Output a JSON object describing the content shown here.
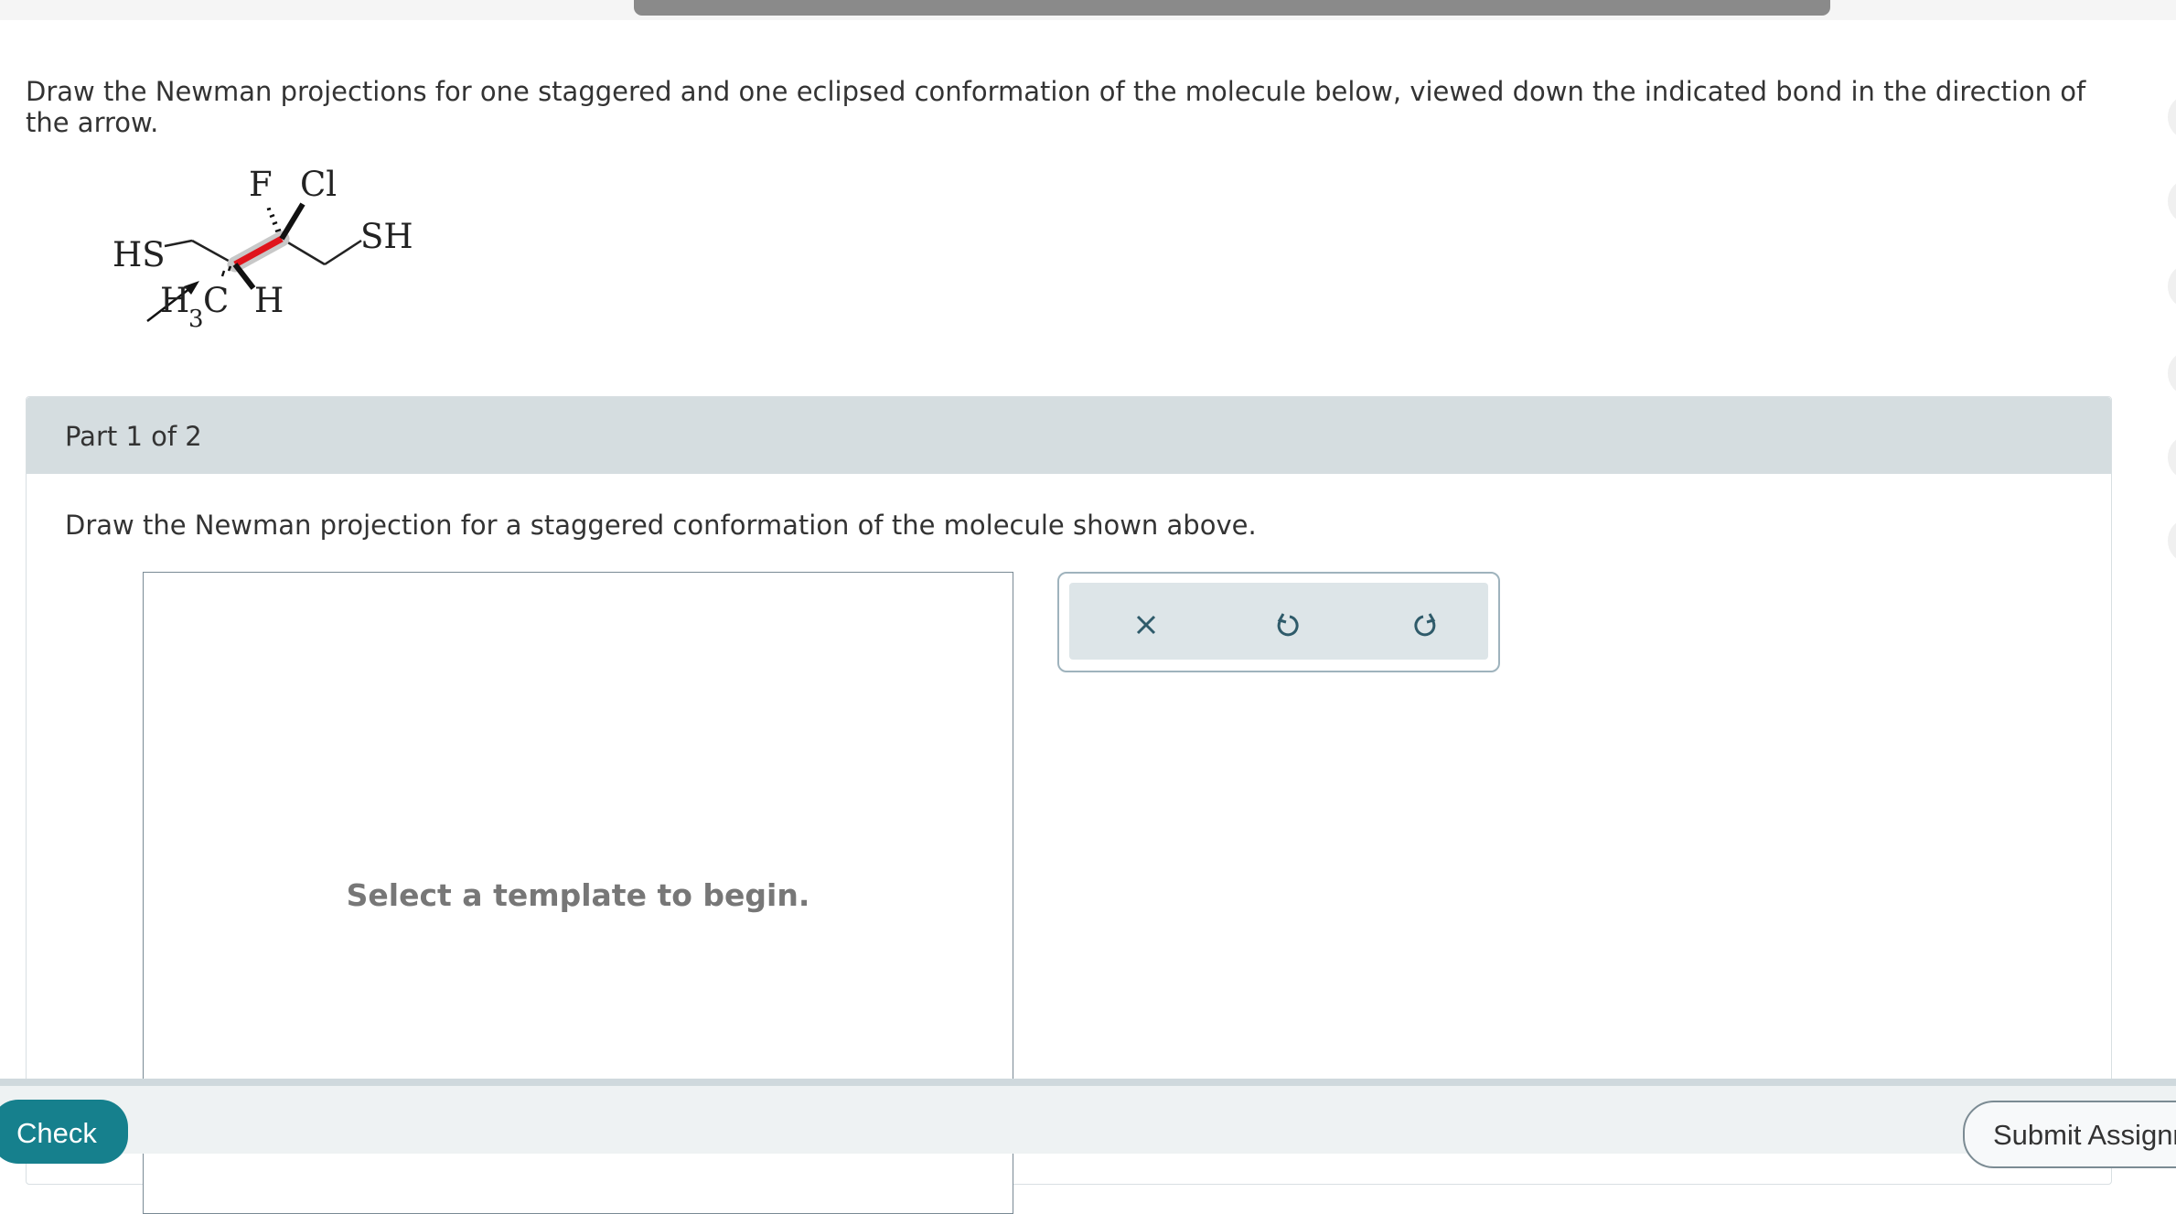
{
  "question": {
    "text": "Draw the Newman projections for one staggered and one eclipsed conformation of the molecule below, viewed down the indicated bond in the direction of the arrow."
  },
  "molecule": {
    "labels": {
      "hs": "HS",
      "f": "F",
      "cl": "Cl",
      "sh": "SH",
      "h3c_h": "H",
      "h3c_sub": "3",
      "h3c_c": "C",
      "h": "H"
    },
    "highlight_bond_color": "#e0141c"
  },
  "part": {
    "label": "Part 1 of 2",
    "instruction": "Draw the Newman projection for a staggered conformation of the molecule shown above."
  },
  "canvas": {
    "message": "Select a template to begin."
  },
  "toolbar": {
    "clear_icon": "close-icon",
    "undo_icon": "undo-icon",
    "redo_icon": "redo-icon"
  },
  "footer": {
    "check_label": "Check",
    "submit_label": "Submit Assignm"
  },
  "colors": {
    "accent": "#16808d",
    "panel_header": "#d5dde0"
  }
}
